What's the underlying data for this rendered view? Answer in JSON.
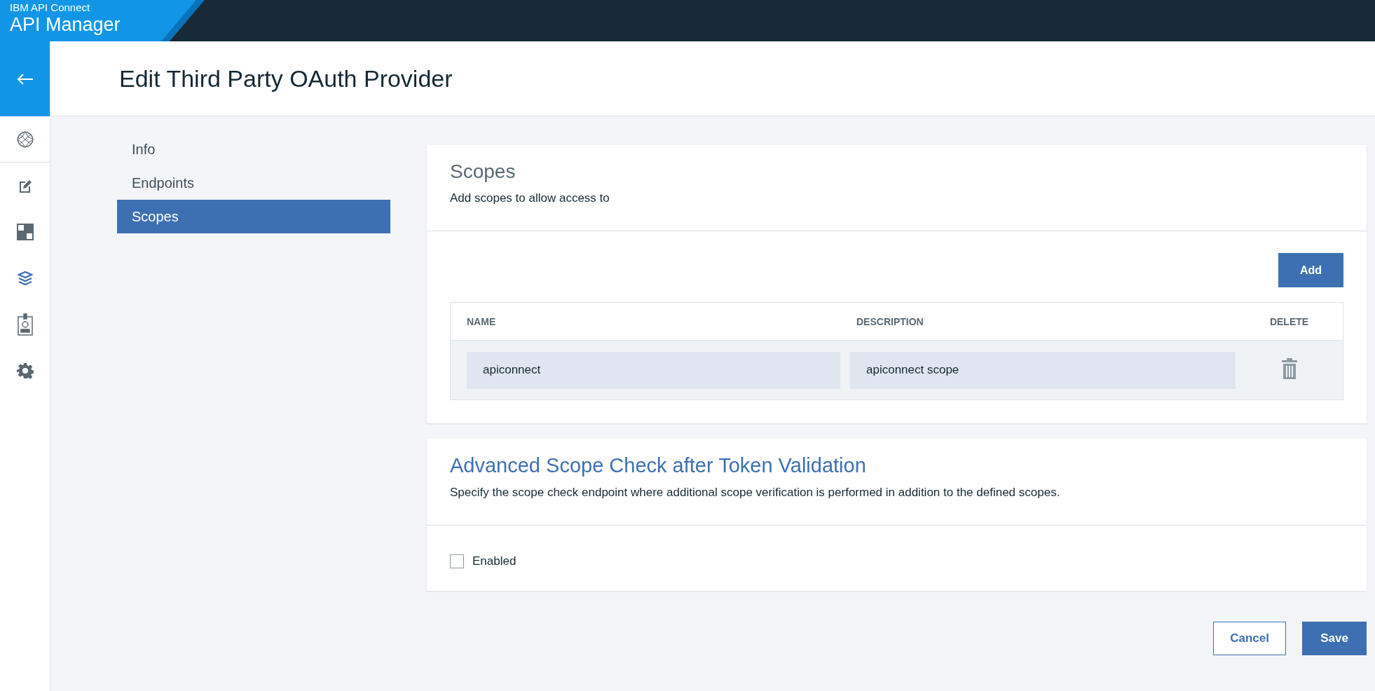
{
  "header": {
    "product": "IBM API Connect",
    "app": "API Manager"
  },
  "rail": [
    {
      "kind": "globe",
      "selected": false
    },
    {
      "kind": "edit",
      "selected": false
    },
    {
      "kind": "dashboard",
      "selected": false
    },
    {
      "kind": "layers",
      "selected": true
    },
    {
      "kind": "badge",
      "selected": false
    },
    {
      "kind": "settings",
      "selected": false
    }
  ],
  "page_title": "Edit Third Party OAuth Provider",
  "side_nav": [
    {
      "label": "Info",
      "selected": false
    },
    {
      "label": "Endpoints",
      "selected": false
    },
    {
      "label": "Scopes",
      "selected": true
    }
  ],
  "scopes": {
    "title": "Scopes",
    "description": "Add scopes to allow access to",
    "add_button": "Add",
    "columns": [
      "NAME",
      "DESCRIPTION",
      "DELETE"
    ],
    "rows": [
      {
        "name": "apiconnect",
        "description": "apiconnect scope"
      }
    ]
  },
  "advanced": {
    "title": "Advanced Scope Check after Token Validation",
    "description": "Specify the scope check endpoint where additional scope verification is performed in addition to the defined scopes.",
    "checkbox": {
      "label": "Enabled",
      "checked": false
    }
  },
  "actions": [
    {
      "label": "Cancel",
      "kind": "secondary"
    },
    {
      "label": "Save",
      "kind": "primary"
    }
  ]
}
